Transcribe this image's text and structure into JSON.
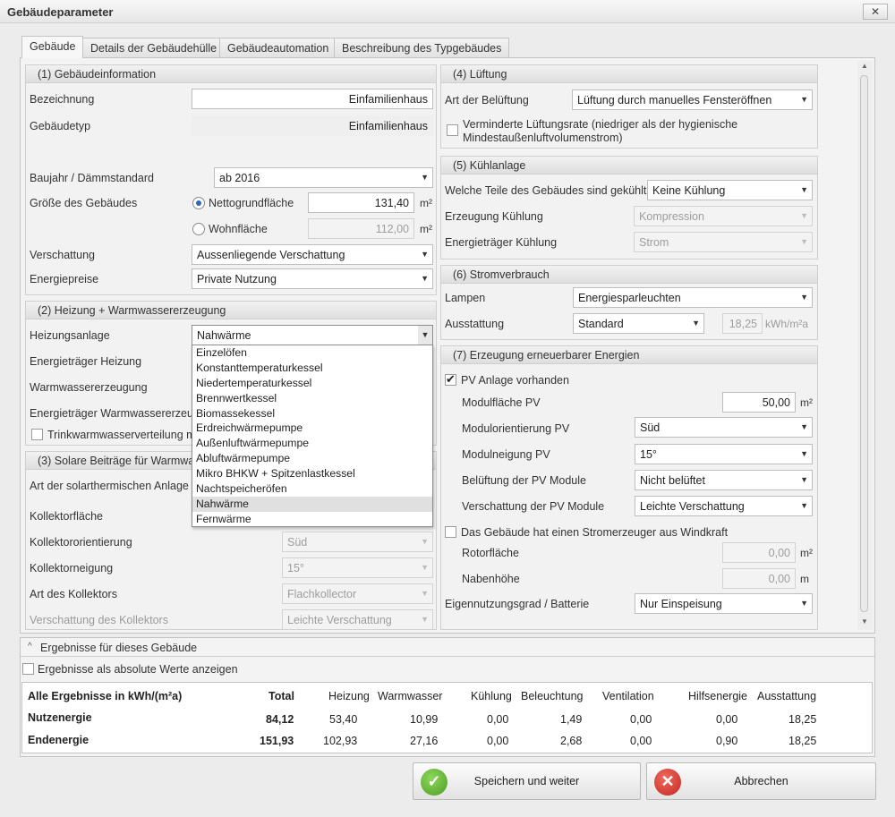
{
  "window": {
    "title": "Gebäudeparameter",
    "close": "✕"
  },
  "tabs": [
    "Gebäude",
    "Details der Gebäudehülle",
    "Gebäudeautomation",
    "Beschreibung des Typgebäudes"
  ],
  "p1": {
    "title": "(1) Gebäudeinformation",
    "bez_label": "Bezeichnung",
    "bez_value": "Einfamilienhaus",
    "typ_label": "Gebäudetyp",
    "typ_value": "Einfamilienhaus",
    "baujahr_label": "Baujahr / Dämmstandard",
    "baujahr_value": "ab 2016",
    "groesse_label": "Größe des Gebäudes",
    "ngf_label": "Nettogrundfläche",
    "ngf_value": "131,40",
    "wfl_label": "Wohnfläche",
    "wfl_value": "112,00",
    "unit_m2": "m²",
    "versch_label": "Verschattung",
    "versch_value": "Aussenliegende Verschattung",
    "preise_label": "Energiepreise",
    "preise_value": "Private Nutzung"
  },
  "p2": {
    "title": "(2) Heizung + Warmwassererzeugung",
    "heiz_label": "Heizungsanlage",
    "heiz_value": "Nahwärme",
    "et_heiz_label": "Energieträger Heizung",
    "ww_label": "Warmwassererzeugung",
    "et_ww_label": "Energieträger Warmwassererzeug",
    "trink_label": "Trinkwarmwasserverteilung mi"
  },
  "dropdown": [
    "Einzelöfen",
    "Konstanttemperaturkessel",
    "Niedertemperaturkessel",
    "Brennwertkessel",
    "Biomassekessel",
    "Erdreichwärmepumpe",
    "Außenluftwärmepumpe",
    "Abluftwärmepumpe",
    "Mikro BHKW + Spitzenlastkessel",
    "Nachtspeicheröfen",
    "Nahwärme",
    "Fernwärme"
  ],
  "p3": {
    "title": "(3) Solare Beiträge für Warmwas",
    "art_label": "Art der solarthermischen Anlage",
    "flaeche_label": "Kollektorfläche",
    "orient_label": "Kollektororientierung",
    "orient_value": "Süd",
    "neig_label": "Kollektorneigung",
    "neig_value": "15°",
    "art_koll_label": "Art des Kollektors",
    "art_koll_value": "Flachkollector",
    "versch_label": "Verschattung des Kollektors",
    "versch_value": "Leichte Verschattung"
  },
  "p4": {
    "title": "(4) Lüftung",
    "art_label": "Art der Belüftung",
    "art_value": "Lüftung durch manuelles Fensteröffnen",
    "vermind_label": "Verminderte Lüftungsrate (niedriger als der hygienische",
    "vermind_label2": "Mindestaußenluftvolumenstrom)"
  },
  "p5": {
    "title": "(5) Kühlanlage",
    "teile_label": "Welche Teile des Gebäudes sind gekühlt?",
    "teile_value": "Keine Kühlung",
    "erz_label": "Erzeugung Kühlung",
    "erz_value": "Kompression",
    "et_label": "Energieträger Kühlung",
    "et_value": "Strom"
  },
  "p6": {
    "title": "(6) Stromverbrauch",
    "lampen_label": "Lampen",
    "lampen_value": "Energiesparleuchten",
    "ausst_label": "Ausstattung",
    "ausst_value": "Standard",
    "ausst_num": "18,25",
    "ausst_unit": "kWh/m²a"
  },
  "p7": {
    "title": "(7) Erzeugung erneuerbarer Energien",
    "pv_label": "PV Anlage vorhanden",
    "modfl_label": "Modulfläche PV",
    "modfl_value": "50,00",
    "modor_label": "Modulorientierung PV",
    "modor_value": "Süd",
    "modneig_label": "Modulneigung PV",
    "modneig_value": "15°",
    "belueft_label": "Belüftung der PV Module",
    "belueft_value": "Nicht belüftet",
    "versch_label": "Verschattung der PV Module",
    "versch_value": "Leichte Verschattung",
    "wind_label": "Das Gebäude hat einen Stromerzeuger aus Windkraft",
    "rotor_label": "Rotorfläche",
    "rotor_value": "0,00",
    "naben_label": "Nabenhöhe",
    "naben_value": "0,00",
    "unit_m": "m",
    "eigen_label": "Eigennutzungsgrad / Batterie",
    "eigen_value": "Nur Einspeisung"
  },
  "results": {
    "title": "Ergebnisse für dieses Gebäude",
    "abs_label": "Ergebnisse als absolute Werte anzeigen",
    "headers": [
      "Alle Ergebnisse in  kWh/(m²a)",
      "Total",
      "Heizung",
      "Warmwasser",
      "Kühlung",
      "Beleuchtung",
      "Ventilation",
      "Hilfsenergie",
      "Ausstattung"
    ],
    "rows": [
      [
        "Nutzenergie",
        "84,12",
        "53,40",
        "10,99",
        "0,00",
        "1,49",
        "0,00",
        "0,00",
        "18,25"
      ],
      [
        "Endenergie",
        "151,93",
        "102,93",
        "27,16",
        "0,00",
        "2,68",
        "0,00",
        "0,90",
        "18,25"
      ]
    ]
  },
  "buttons": {
    "save": "Speichern und weiter",
    "cancel": "Abbrechen",
    "save_icon": "✓",
    "cancel_icon": "✕"
  },
  "colors": {
    "save_icon": "#5db02f",
    "cancel_icon": "#d9302c",
    "radio_selected": "#2a66c4"
  }
}
